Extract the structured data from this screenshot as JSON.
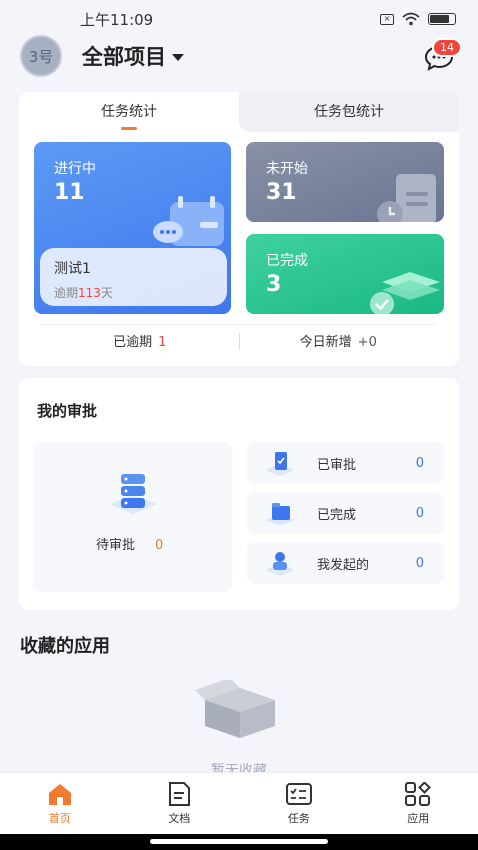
{
  "status_bar": {
    "time": "上午11:09"
  },
  "header": {
    "avatar_text": "3号",
    "project_title": "全部项目",
    "message_badge": "14"
  },
  "stats": {
    "tabs": [
      {
        "label": "任务统计",
        "active": true
      },
      {
        "label": "任务包统计",
        "active": false
      }
    ],
    "in_progress": {
      "label": "进行中",
      "value": "11"
    },
    "not_started": {
      "label": "未开始",
      "value": "31"
    },
    "completed": {
      "label": "已完成",
      "value": "3"
    },
    "overdue_task": {
      "title": "测试1",
      "prefix": "逾期",
      "days": "113",
      "suffix": "天"
    },
    "footer": {
      "overdue_label": "已逾期",
      "overdue_value": "1",
      "new_today_label": "今日新增",
      "new_today_value": "+0"
    }
  },
  "approval": {
    "title": "我的审批",
    "pending": {
      "label": "待审批",
      "value": "0"
    },
    "rows": [
      {
        "label": "已审批",
        "value": "0"
      },
      {
        "label": "已完成",
        "value": "0"
      },
      {
        "label": "我发起的",
        "value": "0"
      }
    ]
  },
  "favorites": {
    "title": "收藏的应用",
    "empty_text": "暂无收藏"
  },
  "tabbar": {
    "items": [
      {
        "label": "首页",
        "icon": "home-icon",
        "active": true
      },
      {
        "label": "文档",
        "icon": "document-icon",
        "active": false
      },
      {
        "label": "任务",
        "icon": "task-icon",
        "active": false
      },
      {
        "label": "应用",
        "icon": "apps-icon",
        "active": false
      }
    ]
  },
  "colors": {
    "accent": "#f27a2f",
    "blue": "#3e76ee",
    "green": "#1bb883",
    "grey": "#6b7590",
    "alert": "#f0463c"
  }
}
